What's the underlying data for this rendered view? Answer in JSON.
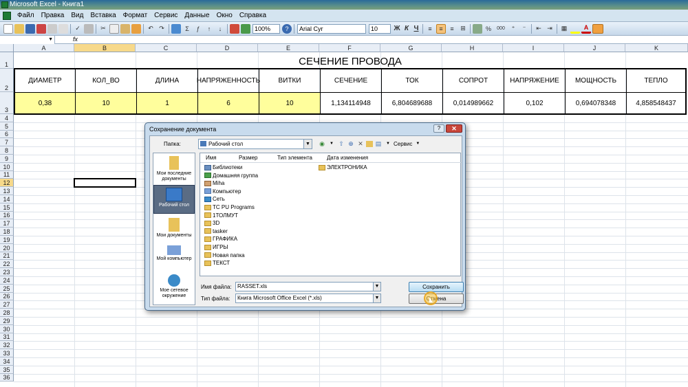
{
  "window": {
    "title": "Microsoft Excel - Книга1"
  },
  "menu": [
    "Файл",
    "Правка",
    "Вид",
    "Вставка",
    "Формат",
    "Сервис",
    "Данные",
    "Окно",
    "Справка"
  ],
  "toolbar": {
    "zoom": "100%",
    "font": "Arial Cyr",
    "size": "10",
    "bold": "Ж",
    "italic": "К",
    "underline": "Ч",
    "percent": "%",
    "thousands": "000"
  },
  "formula_bar": {
    "fx": "fx"
  },
  "columns": [
    "A",
    "B",
    "C",
    "D",
    "E",
    "F",
    "G",
    "H",
    "I",
    "J",
    "K"
  ],
  "rows": [
    "1",
    "2",
    "3",
    "4",
    "5",
    "6",
    "7",
    "8",
    "9",
    "10",
    "11",
    "12",
    "13",
    "14",
    "15",
    "16",
    "17",
    "18",
    "19",
    "20",
    "21",
    "22",
    "23",
    "24",
    "25",
    "26",
    "27",
    "28",
    "29",
    "30",
    "31",
    "32",
    "33",
    "34",
    "35",
    "36"
  ],
  "sheet": {
    "title": "СЕЧЕНИЕ ПРОВОДА",
    "headers": [
      "ДИАМЕТР",
      "КОЛ_ВО",
      "ДЛИНА",
      "НАПРЯЖЕННОСТЬ",
      "ВИТКИ",
      "СЕЧЕНИЕ",
      "ТОК",
      "СОПРОТ",
      "НАПРЯЖЕНИЕ",
      "МОЩНОСТЬ",
      "ТЕПЛО"
    ],
    "values": [
      "0,38",
      "10",
      "1",
      "6",
      "10",
      "1,134114948",
      "6,804689688",
      "0,014989662",
      "0,102",
      "0,694078348",
      "4,858548437"
    ]
  },
  "dialog": {
    "title": "Сохранение документа",
    "help": "?",
    "close": "✕",
    "folder_label": "Папка:",
    "folder_value": "Рабочий стол",
    "tools_label": "Сервис",
    "places": [
      "Мои последние документы",
      "Рабочий стол",
      "Мои документы",
      "Мой компьютер",
      "Мое сетевое окружение"
    ],
    "columns": [
      "Имя",
      "Размер",
      "Тип элемента",
      "Дата изменения"
    ],
    "items_col1": [
      "Библиотеки",
      "Домашняя группа",
      "Miha",
      "Компьютер",
      "Сеть",
      "TC PU Programs",
      "1ТОЛМУТ",
      "3D",
      "tasker",
      "ГРАФИКА",
      "ИГРЫ",
      "Новая папка",
      "ТЕКСТ"
    ],
    "items_col2": [
      "ЭЛЕКТРОНИКА"
    ],
    "filename_label": "Имя файла:",
    "filename_value": "RASSET.xls",
    "filetype_label": "Тип файла:",
    "filetype_value": "Книга Microsoft Office Excel (*.xls)",
    "save_button": "Сохранить",
    "cancel_button": "Отмена"
  }
}
